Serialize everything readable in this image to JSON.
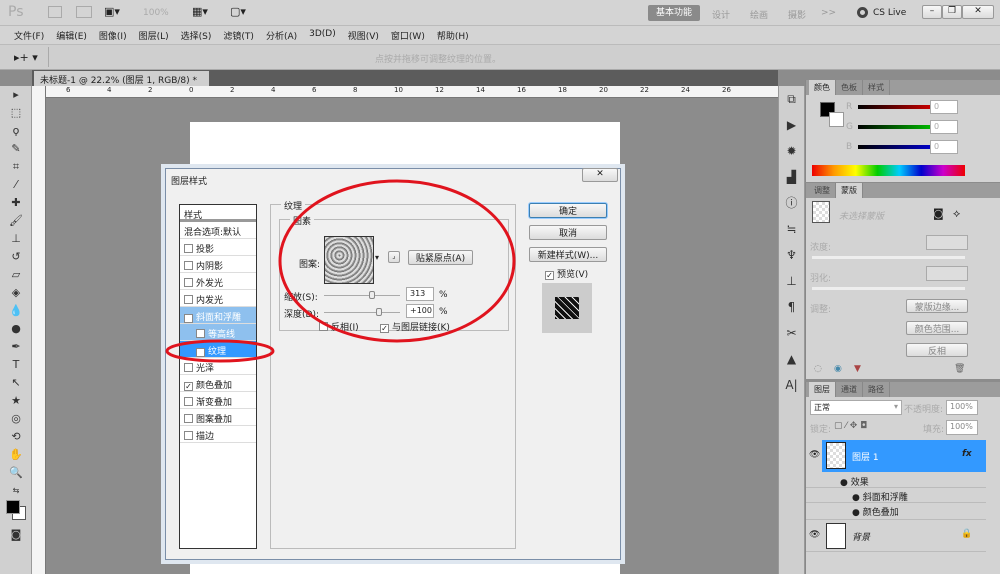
{
  "app": {
    "logo": "Ps",
    "zoom": "100%",
    "workspaces": [
      "基本功能",
      "设计",
      "绘画",
      "摄影"
    ],
    "more": ">>",
    "cs_live": "CS Live"
  },
  "menu": [
    "文件(F)",
    "编辑(E)",
    "图像(I)",
    "图层(L)",
    "选择(S)",
    "滤镜(T)",
    "分析(A)",
    "3D(D)",
    "视图(V)",
    "窗口(W)",
    "帮助(H)"
  ],
  "options": {
    "hint": "点按并拖移可调整纹理的位置。"
  },
  "document": {
    "tab": "未标题-1 @ 22.2% (图层 1, RGB/8) *",
    "ruler_ticks": [
      "6",
      "4",
      "2",
      "0",
      "2",
      "4",
      "6",
      "8",
      "10",
      "12",
      "14",
      "16",
      "18",
      "20",
      "22",
      "24",
      "26"
    ]
  },
  "dialog": {
    "title": "图层样式",
    "styles_header": "样式",
    "blend_options": "混合选项:默认",
    "styles": [
      {
        "label": "投影",
        "checked": false
      },
      {
        "label": "内阴影",
        "checked": false
      },
      {
        "label": "外发光",
        "checked": false
      },
      {
        "label": "内发光",
        "checked": false
      },
      {
        "label": "斜面和浮雕",
        "checked": true
      },
      {
        "label": "等高线",
        "checked": false
      },
      {
        "label": "纹理",
        "checked": true
      },
      {
        "label": "光泽",
        "checked": false
      },
      {
        "label": "颜色叠加",
        "checked": true
      },
      {
        "label": "渐变叠加",
        "checked": false
      },
      {
        "label": "图案叠加",
        "checked": false
      },
      {
        "label": "描边",
        "checked": false
      }
    ],
    "section": "纹理",
    "group": "图素",
    "pattern_label": "图案:",
    "snap_button": "贴紧原点(A)",
    "scale_label": "缩放(S):",
    "scale_value": "313",
    "scale_unit": "%",
    "scale_fraction": 0.63,
    "depth_label": "深度(D):",
    "depth_value": "+100",
    "depth_unit": "%",
    "depth_fraction": 0.72,
    "invert_label": "反相(I)",
    "invert_checked": false,
    "link_label": "与图层链接(K)",
    "link_checked": true,
    "ok": "确定",
    "cancel": "取消",
    "new_style": "新建样式(W)...",
    "preview_label": "预览(V)",
    "preview_checked": true
  },
  "color_panel": {
    "tabs": [
      "颜色",
      "色板",
      "样式"
    ],
    "channels": [
      {
        "label": "R",
        "value": "0",
        "color": "#d00000"
      },
      {
        "label": "G",
        "value": "0",
        "color": "#00c000"
      },
      {
        "label": "B",
        "value": "0",
        "color": "#0000d0"
      }
    ]
  },
  "masks_panel": {
    "tabs": [
      "调整",
      "蒙版"
    ],
    "no_mask": "未选择蒙版",
    "density": "浓度:",
    "feather": "羽化:",
    "refine": "调整:",
    "mask_edge": "蒙版边缘...",
    "color_range": "颜色范围...",
    "invert": "反相"
  },
  "layers_panel": {
    "tabs": [
      "图层",
      "通道",
      "路径"
    ],
    "blend_mode": "正常",
    "opacity_label": "不透明度:",
    "opacity": "100%",
    "lock_label": "锁定:",
    "fill_label": "填充:",
    "fill": "100%",
    "layers": [
      {
        "name": "图层 1",
        "fx": "fx",
        "selected": true
      },
      {
        "name": "背景",
        "selected": false
      }
    ],
    "effects_label": "效果",
    "effects": [
      "斜面和浮雕",
      "颜色叠加"
    ]
  },
  "accent": "#3399ff",
  "annotation_color": "#e0141e"
}
